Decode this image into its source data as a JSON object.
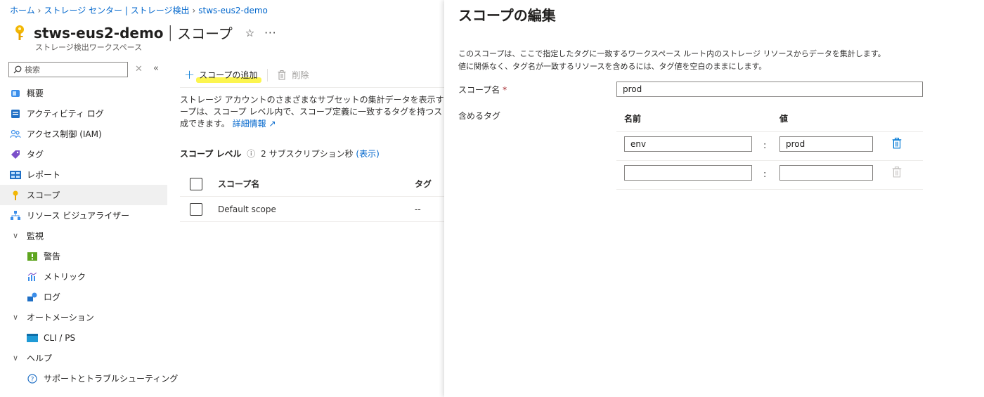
{
  "breadcrumb": {
    "home": "ホーム",
    "storage_center": "ストレージ センター | ストレージ検出",
    "workspace": "stws-eus2-demo"
  },
  "header": {
    "resource_name": "stws-eus2-demo",
    "separator": "|",
    "page_title": "スコープ",
    "subtitle": "ストレージ検出ワークスペース",
    "star": "☆",
    "more": "···"
  },
  "search": {
    "placeholder": "検索"
  },
  "sidebar": {
    "items": [
      {
        "label": "概要"
      },
      {
        "label": "アクティビティ ログ"
      },
      {
        "label": "アクセス制御 (IAM)"
      },
      {
        "label": "タグ"
      },
      {
        "label": "レポート"
      },
      {
        "label": "スコープ"
      },
      {
        "label": "リソース ビジュアライザー"
      },
      {
        "label": "監視"
      },
      {
        "label": "警告"
      },
      {
        "label": "メトリック"
      },
      {
        "label": "ログ"
      },
      {
        "label": "オートメーション"
      },
      {
        "label": "CLI / PS"
      },
      {
        "label": "ヘルプ"
      },
      {
        "label": "サポートとトラブルシューティング"
      }
    ]
  },
  "toolbar": {
    "add_scope": "スコープの追加",
    "delete": "削除"
  },
  "main": {
    "desc_line1": "ストレージ アカウントのさまざまなサブセットの集計データを表示するためにスコープを作成します。ス",
    "desc_line2": "ープは、スコープ レベル内で、スコープ定義に一致するタグを持つストレージ アカウントから作",
    "desc_line3": "成できます。",
    "learn_more": "詳細情報",
    "scope_level_label": "スコープ レベル",
    "scope_level_value": "2 サブスクリプション秒",
    "show_link": "(表示)",
    "table": {
      "col_name": "スコープ名",
      "col_tags": "タグ",
      "rows": [
        {
          "name": "Default scope",
          "tags": "--"
        }
      ]
    }
  },
  "panel": {
    "title": "スコープの編集",
    "desc_line1": "このスコープは、ここで指定したタグに一致するワークスペース ルート内のストレージ リソースからデータを集計します。",
    "desc_line2": "値に関係なく、タグ名が一致するリソースを含めるには、タグ値を空白のままにします。",
    "scope_name_label": "スコープ名",
    "required_mark": "*",
    "scope_name_value": "prod",
    "include_tags_label": "含めるタグ",
    "tag_col_name": "名前",
    "tag_col_value": "値",
    "colon": ":",
    "tags": [
      {
        "name": "env",
        "value": "prod"
      },
      {
        "name": "",
        "value": ""
      }
    ]
  },
  "colors": {
    "link": "#0066cc",
    "accent": "#0078d4",
    "highlight": "#fbf330",
    "required": "#a4262c"
  }
}
